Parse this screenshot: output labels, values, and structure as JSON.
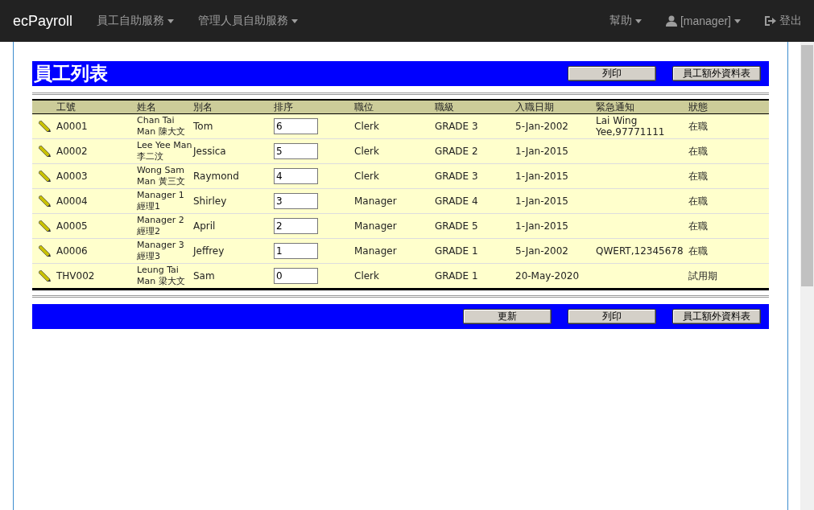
{
  "navbar": {
    "brand": "ecPayroll",
    "menus": [
      {
        "label": "員工自助服務"
      },
      {
        "label": "管理人員自助服務"
      }
    ],
    "right_menus": [
      {
        "label": "幫助",
        "kind": "dropdown"
      },
      {
        "label": "[manager]",
        "kind": "user"
      },
      {
        "label": "登出",
        "kind": "logout"
      }
    ]
  },
  "title_bar": {
    "title": "員工列表",
    "buttons": [
      "列印",
      "員工額外資料表"
    ]
  },
  "table": {
    "columns": [
      "工號",
      "姓名",
      "別名",
      "排序",
      "職位",
      "職級",
      "入職日期",
      "緊急通知",
      "狀態"
    ],
    "rows": [
      {
        "id": "A0001",
        "name": "Chan Tai Man 陳大文",
        "alias": "Tom",
        "order": "6",
        "position": "Clerk",
        "grade": "GRADE 3",
        "join_date": "5-Jan-2002",
        "emergency": "Lai Wing Yee,97771111",
        "status": "在職"
      },
      {
        "id": "A0002",
        "name": "Lee Yee Man 李二汶",
        "alias": "Jessica",
        "order": "5",
        "position": "Clerk",
        "grade": "GRADE 2",
        "join_date": "1-Jan-2015",
        "emergency": "",
        "status": "在職"
      },
      {
        "id": "A0003",
        "name": "Wong Sam Man 黃三文",
        "alias": "Raymond",
        "order": "4",
        "position": "Clerk",
        "grade": "GRADE 3",
        "join_date": "1-Jan-2015",
        "emergency": "",
        "status": "在職"
      },
      {
        "id": "A0004",
        "name": "Manager 1 經理1",
        "alias": "Shirley",
        "order": "3",
        "position": "Manager",
        "grade": "GRADE 4",
        "join_date": "1-Jan-2015",
        "emergency": "",
        "status": "在職"
      },
      {
        "id": "A0005",
        "name": "Manager 2 經理2",
        "alias": "April",
        "order": "2",
        "position": "Manager",
        "grade": "GRADE 5",
        "join_date": "1-Jan-2015",
        "emergency": "",
        "status": "在職"
      },
      {
        "id": "A0006",
        "name": "Manager 3 經理3",
        "alias": "Jeffrey",
        "order": "1",
        "position": "Manager",
        "grade": "GRADE 1",
        "join_date": "5-Jan-2002",
        "emergency": "QWERT,12345678",
        "status": "在職"
      },
      {
        "id": "THV002",
        "name": "Leung Tai Man 梁大文",
        "alias": "Sam",
        "order": "0",
        "position": "Clerk",
        "grade": "GRADE 1",
        "join_date": "20-May-2020",
        "emergency": "",
        "status": "試用期"
      }
    ]
  },
  "bottom_bar": {
    "buttons": [
      "更新",
      "列印",
      "員工額外資料表"
    ]
  }
}
